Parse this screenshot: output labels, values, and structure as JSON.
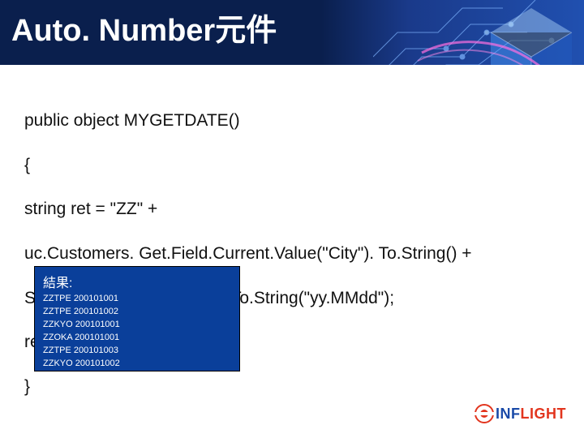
{
  "header": {
    "title": "Auto. Number元件"
  },
  "code": {
    "line1": "public object MYGETDATE()",
    "line2": "{",
    "line3": "   string ret = \"ZZ\" +",
    "line4": "uc.Customers. Get.Field.Current.Value(\"City\"). To.String() +",
    "line5": "System. Date.Time. Today. To.String(\"yy.MMdd\");",
    "line6": "   return ret;",
    "line7": "}"
  },
  "result": {
    "label": "結果:",
    "lines": [
      "ZZTPE 200101001",
      "ZZTPE 200101002",
      "ZZKYO 200101001",
      "ZZOKA 200101001",
      "ZZTPE 200101003",
      "ZZKYO 200101002"
    ]
  },
  "logo": {
    "text_info": "INF",
    "text_light": "LIGHT"
  }
}
